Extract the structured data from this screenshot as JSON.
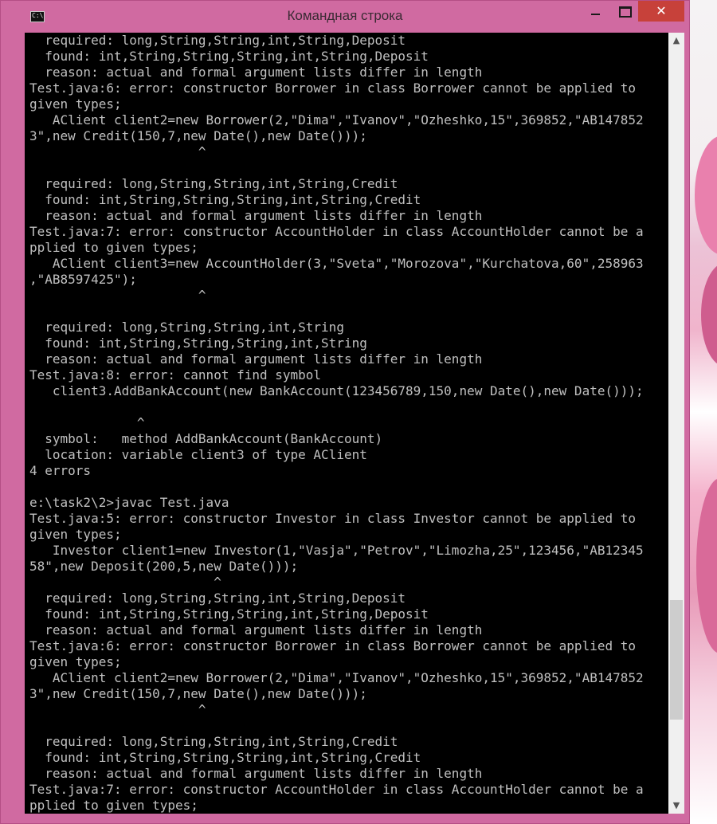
{
  "window": {
    "title": "Командная строка",
    "app_icon_text": "C:\\"
  },
  "controls": {
    "close_glyph": "✕"
  },
  "scrollbar": {
    "up_glyph": "▲",
    "down_glyph": "▼"
  },
  "console": {
    "lines": [
      "  required: long,String,String,int,String,Deposit",
      "  found: int,String,String,String,int,String,Deposit",
      "  reason: actual and formal argument lists differ in length",
      "Test.java:6: error: constructor Borrower in class Borrower cannot be applied to",
      "given types;",
      "   AClient client2=new Borrower(2,\"Dima\",\"Ivanov\",\"Ozheshko,15\",369852,\"AB147852",
      "3\",new Credit(150,7,new Date(),new Date()));",
      "                      ^",
      "",
      "  required: long,String,String,int,String,Credit",
      "  found: int,String,String,String,int,String,Credit",
      "  reason: actual and formal argument lists differ in length",
      "Test.java:7: error: constructor AccountHolder in class AccountHolder cannot be a",
      "pplied to given types;",
      "   AClient client3=new AccountHolder(3,\"Sveta\",\"Morozova\",\"Kurchatova,60\",258963",
      ",\"AB8597425\");",
      "                      ^",
      "",
      "  required: long,String,String,int,String",
      "  found: int,String,String,String,int,String",
      "  reason: actual and formal argument lists differ in length",
      "Test.java:8: error: cannot find symbol",
      "   client3.AddBankAccount(new BankAccount(123456789,150,new Date(),new Date()));",
      "",
      "              ^",
      "  symbol:   method AddBankAccount(BankAccount)",
      "  location: variable client3 of type AClient",
      "4 errors",
      "",
      "e:\\task2\\2>javac Test.java",
      "Test.java:5: error: constructor Investor in class Investor cannot be applied to",
      "given types;",
      "   Investor client1=new Investor(1,\"Vasja\",\"Petrov\",\"Limozha,25\",123456,\"AB12345",
      "58\",new Deposit(200,5,new Date()));",
      "                        ^",
      "  required: long,String,String,int,String,Deposit",
      "  found: int,String,String,String,int,String,Deposit",
      "  reason: actual and formal argument lists differ in length",
      "Test.java:6: error: constructor Borrower in class Borrower cannot be applied to",
      "given types;",
      "   AClient client2=new Borrower(2,\"Dima\",\"Ivanov\",\"Ozheshko,15\",369852,\"AB147852",
      "3\",new Credit(150,7,new Date(),new Date()));",
      "                      ^",
      "",
      "  required: long,String,String,int,String,Credit",
      "  found: int,String,String,String,int,String,Credit",
      "  reason: actual and formal argument lists differ in length",
      "Test.java:7: error: constructor AccountHolder in class AccountHolder cannot be a",
      "pplied to given types;",
      "   AClient client3=new AccountHolder(3,\"Sveta\",\"Morozova\",\"Kurchatova,60\",258963",
      ",\"AB8597425\");",
      "                      ^"
    ]
  }
}
